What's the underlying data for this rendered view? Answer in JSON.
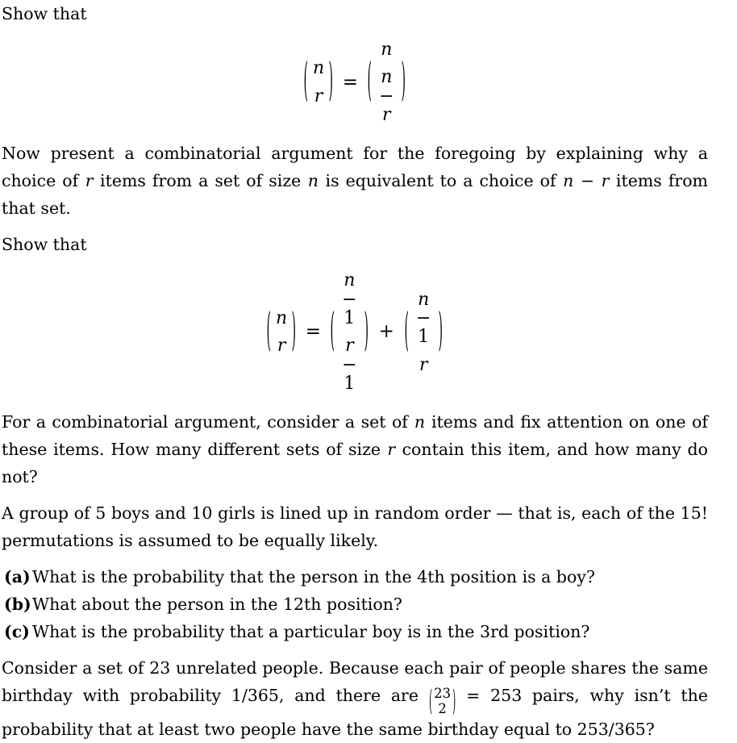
{
  "document": {
    "background_color": "#ffffff",
    "text_color": "#000000"
  },
  "blocks": {
    "show_that_1": "Show that",
    "show_that_2": "Show that",
    "equation_1": {
      "description": "binomial symmetry identity",
      "latex": "\\binom{n}{r} = \\binom{n}{n-r}",
      "left": {
        "top": "n",
        "bottom": "r"
      },
      "relation": "=",
      "right": {
        "top": "n",
        "bottom_left": "n",
        "bottom_minus": "−",
        "bottom_right": "r"
      }
    },
    "equation_2": {
      "description": "Pascal's rule",
      "latex": "\\binom{n}{r} = \\binom{n-1}{r-1} + \\binom{n-1}{r}",
      "term1": {
        "top": "n",
        "bottom": "r"
      },
      "relation": "=",
      "term2": {
        "top_left": "n",
        "top_minus": "−",
        "top_right": "1",
        "bottom_left": "r",
        "bottom_minus": "−",
        "bottom_right": "1"
      },
      "operator": "+",
      "term3": {
        "top_left": "n",
        "top_minus": "−",
        "top_right": "1",
        "bottom": "r"
      }
    },
    "para_combinatorial_1": {
      "part1": "Now present a combinatorial argument for the foregoing by explaining why a choice of ",
      "var1": "r",
      "part2": " items from a set of size ",
      "var2": "n",
      "part3": " is equivalent to a choice of ",
      "var3": "n",
      "part4": " − ",
      "var4": "r",
      "part5": " items from that set."
    },
    "para_combinatorial_2": {
      "part1": "For a combinatorial argument, consider a set of ",
      "var1": "n",
      "part2": " items and fix attention on one of these items. How many different sets of size ",
      "var2": "r",
      "part3": " contain this item, and how many do not?"
    },
    "para_group": "A group of 5 boys and 10 girls is lined up in random order — that is, each of the 15! permutations is assumed to be equally likely.",
    "questions": [
      {
        "label": "(a)",
        "text": "What is the probability that the person in the 4th position is a boy?"
      },
      {
        "label": "(b)",
        "text": "What about the person in the 12th position?"
      },
      {
        "label": "(c)",
        "text": "What is the probability that a particular boy is in the 3rd position?"
      }
    ],
    "para_birthday": {
      "part1": "Consider a set of 23 unrelated people. Because each pair of people shares the same birthday with probability 1/365, and there are ",
      "inline_binom": {
        "top": "23",
        "bottom": "2"
      },
      "part2": " = 253 pairs, why isn’t the probability that at least two people have the same birthday equal to 253/365?"
    }
  }
}
